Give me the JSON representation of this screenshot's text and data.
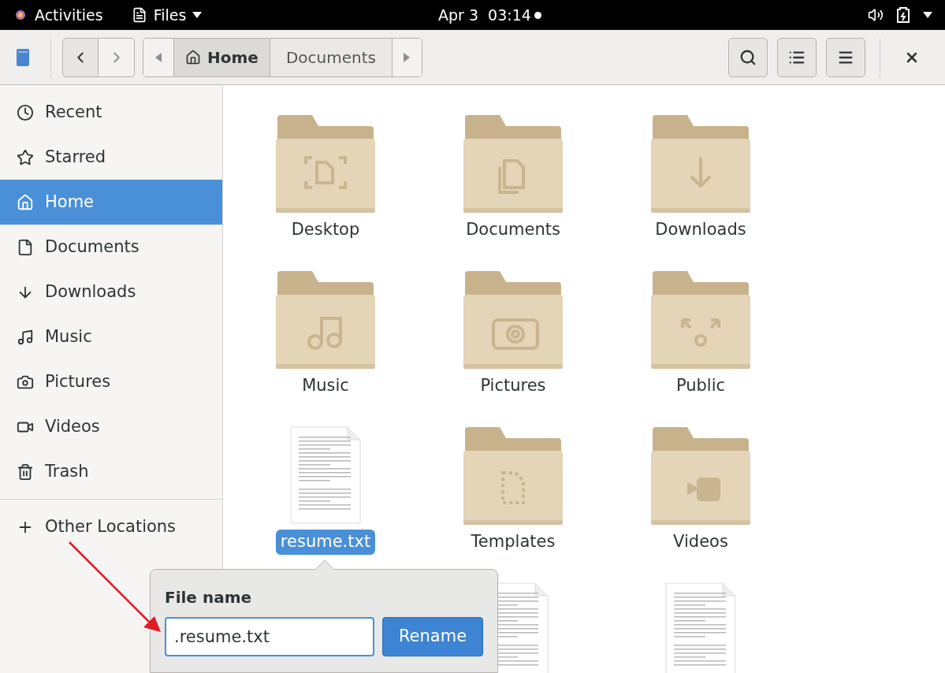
{
  "top_bar": {
    "activities": "Activities",
    "app_menu": "Files",
    "clock": "Apr 3  03:14"
  },
  "toolbar": {
    "path": [
      {
        "label": "Home",
        "selected": true
      },
      {
        "label": "Documents",
        "selected": false
      }
    ]
  },
  "sidebar": {
    "items": [
      {
        "label": "Recent",
        "selected": false
      },
      {
        "label": "Starred",
        "selected": false
      },
      {
        "label": "Home",
        "selected": true
      },
      {
        "label": "Documents",
        "selected": false
      },
      {
        "label": "Downloads",
        "selected": false
      },
      {
        "label": "Music",
        "selected": false
      },
      {
        "label": "Pictures",
        "selected": false
      },
      {
        "label": "Videos",
        "selected": false
      },
      {
        "label": "Trash",
        "selected": false
      }
    ],
    "other": {
      "label": "Other Locations"
    }
  },
  "files": [
    {
      "kind": "folder",
      "label": "Desktop",
      "selected": false
    },
    {
      "kind": "folder",
      "label": "Documents",
      "selected": false
    },
    {
      "kind": "folder",
      "label": "Downloads",
      "selected": false
    },
    {
      "kind": "folder",
      "label": "Music",
      "selected": false
    },
    {
      "kind": "folder",
      "label": "Pictures",
      "selected": false
    },
    {
      "kind": "folder",
      "label": "Public",
      "selected": false
    },
    {
      "kind": "document",
      "label": "resume.txt",
      "selected": true
    },
    {
      "kind": "folder",
      "label": "Templates",
      "selected": false
    },
    {
      "kind": "folder",
      "label": "Videos",
      "selected": false
    },
    {
      "kind": "empty"
    },
    {
      "kind": "document"
    },
    {
      "kind": "document"
    }
  ],
  "rename_popover": {
    "title": "File name",
    "value": ".resume.txt",
    "button": "Rename"
  }
}
